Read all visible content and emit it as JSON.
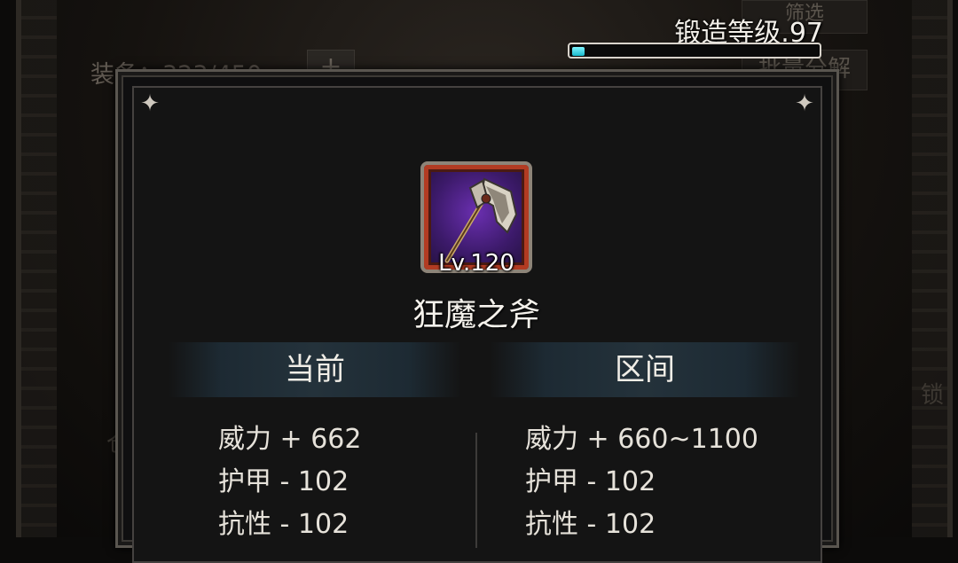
{
  "background": {
    "equip_count": "装备：323/450",
    "add_button": "+",
    "filter_button": "筛选",
    "decompose_button": "批量分解",
    "left_partial": "仓",
    "right_partial": "锁"
  },
  "forge": {
    "label": "锻造等级.97",
    "progress": 0.05,
    "accent_color": "#2ad3e6"
  },
  "dialog": {
    "item": {
      "icon": "battle-axe-icon",
      "level": "Lv.120",
      "name": "狂魔之斧",
      "frame_color": "#b23b22"
    },
    "current": {
      "header": "当前",
      "stats": [
        "威力 + 662",
        "护甲 - 102",
        "抗性 - 102"
      ]
    },
    "range": {
      "header": "区间",
      "stats": [
        "威力 + 660~1100",
        "护甲 - 102",
        "抗性 - 102"
      ]
    },
    "corner_icon": "✦"
  }
}
